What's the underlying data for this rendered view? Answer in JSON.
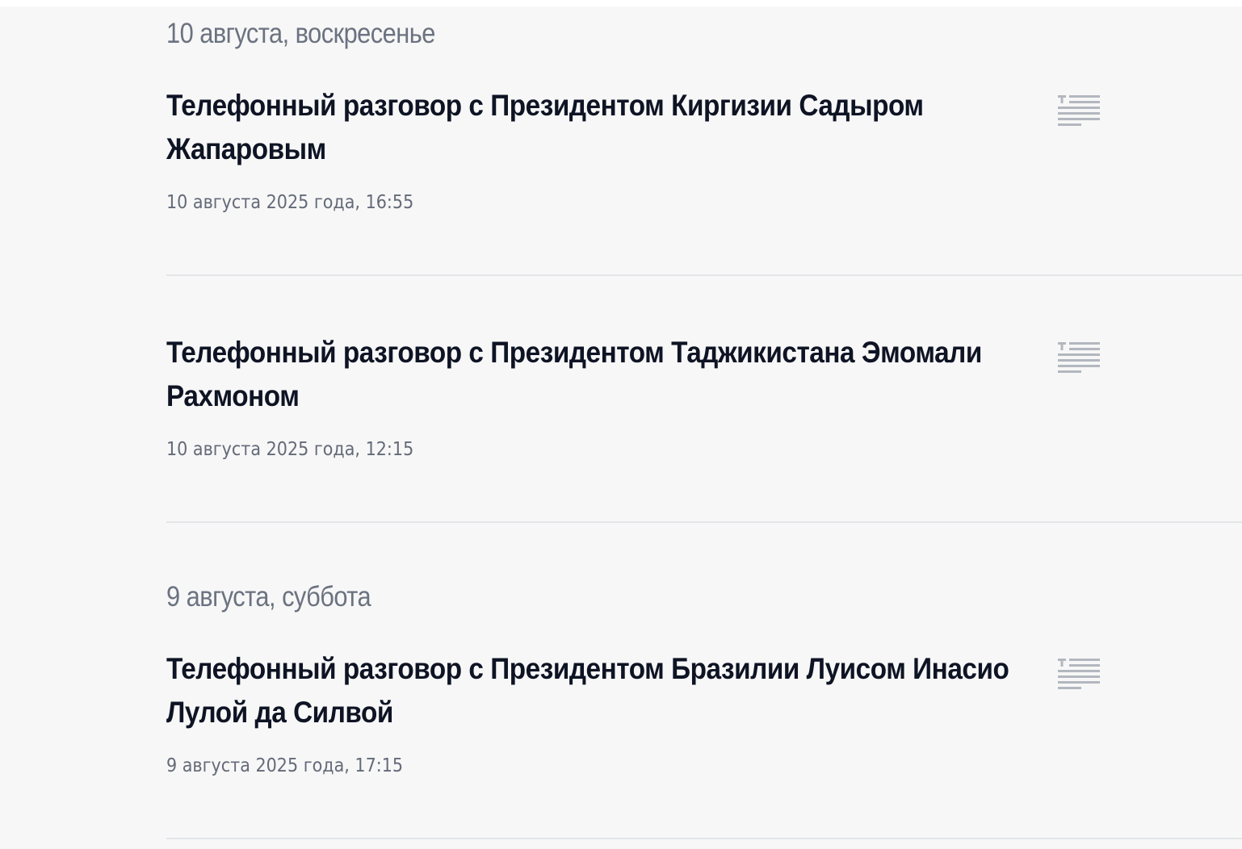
{
  "days": [
    {
      "heading": "10 августа, воскресенье",
      "items": [
        {
          "title": "Телефонный разговор с Президентом Киргизии Садыром Жапаровым",
          "datetime": "10 августа 2025 года, 16:55",
          "type_icon": "text-document-icon"
        },
        {
          "title": "Телефонный разговор с Президентом Таджикистана Эмомали Рахмоном",
          "datetime": "10 августа 2025 года, 12:15",
          "type_icon": "text-document-icon"
        }
      ]
    },
    {
      "heading": "9 августа, суббота",
      "items": [
        {
          "title": "Телефонный разговор с Президентом Бразилии Луисом Инасио Лулой да Силвой",
          "datetime": "9 августа 2025 года, 17:15",
          "type_icon": "text-document-icon"
        }
      ]
    }
  ],
  "colors": {
    "background": "#f7f7f7",
    "heading": "#6b7280",
    "title": "#0e1424",
    "meta": "#646a78",
    "divider": "#e3e5e8",
    "icon": "#b3b7bf"
  }
}
